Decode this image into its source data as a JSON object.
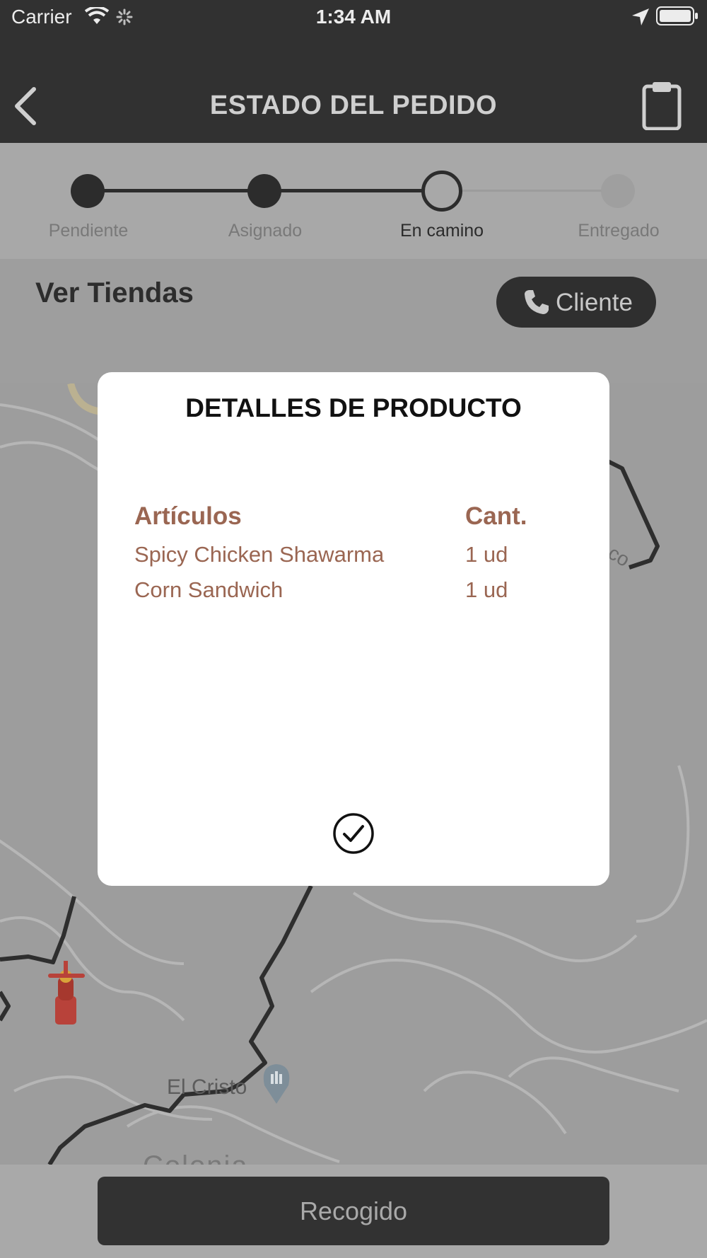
{
  "status_bar": {
    "carrier": "Carrier",
    "time": "1:34 AM"
  },
  "header": {
    "title": "ESTADO DEL PEDIDO"
  },
  "steps": [
    {
      "label": "Pendiente",
      "state": "done"
    },
    {
      "label": "Asignado",
      "state": "done"
    },
    {
      "label": "En camino",
      "state": "current"
    },
    {
      "label": "Entregado",
      "state": "pending"
    }
  ],
  "stores": {
    "title": "Ver Tiendas",
    "client_button": "Cliente"
  },
  "map": {
    "place_label": "El Cristo",
    "partial_label": "Colonia",
    "partial_label_2": "co"
  },
  "modal": {
    "title": "DETALLES DE PRODUCTO",
    "col_items": "Artículos",
    "col_qty": "Cant.",
    "rows": [
      {
        "item": "Spicy Chicken Shawarma",
        "qty": "1 ud"
      },
      {
        "item": "Corn Sandwich",
        "qty": "1 ud"
      }
    ]
  },
  "footer": {
    "button": "Recogido"
  },
  "colors": {
    "dark": "#313131",
    "accent_text": "#9a6652",
    "overlay": "#a9a9a9"
  }
}
